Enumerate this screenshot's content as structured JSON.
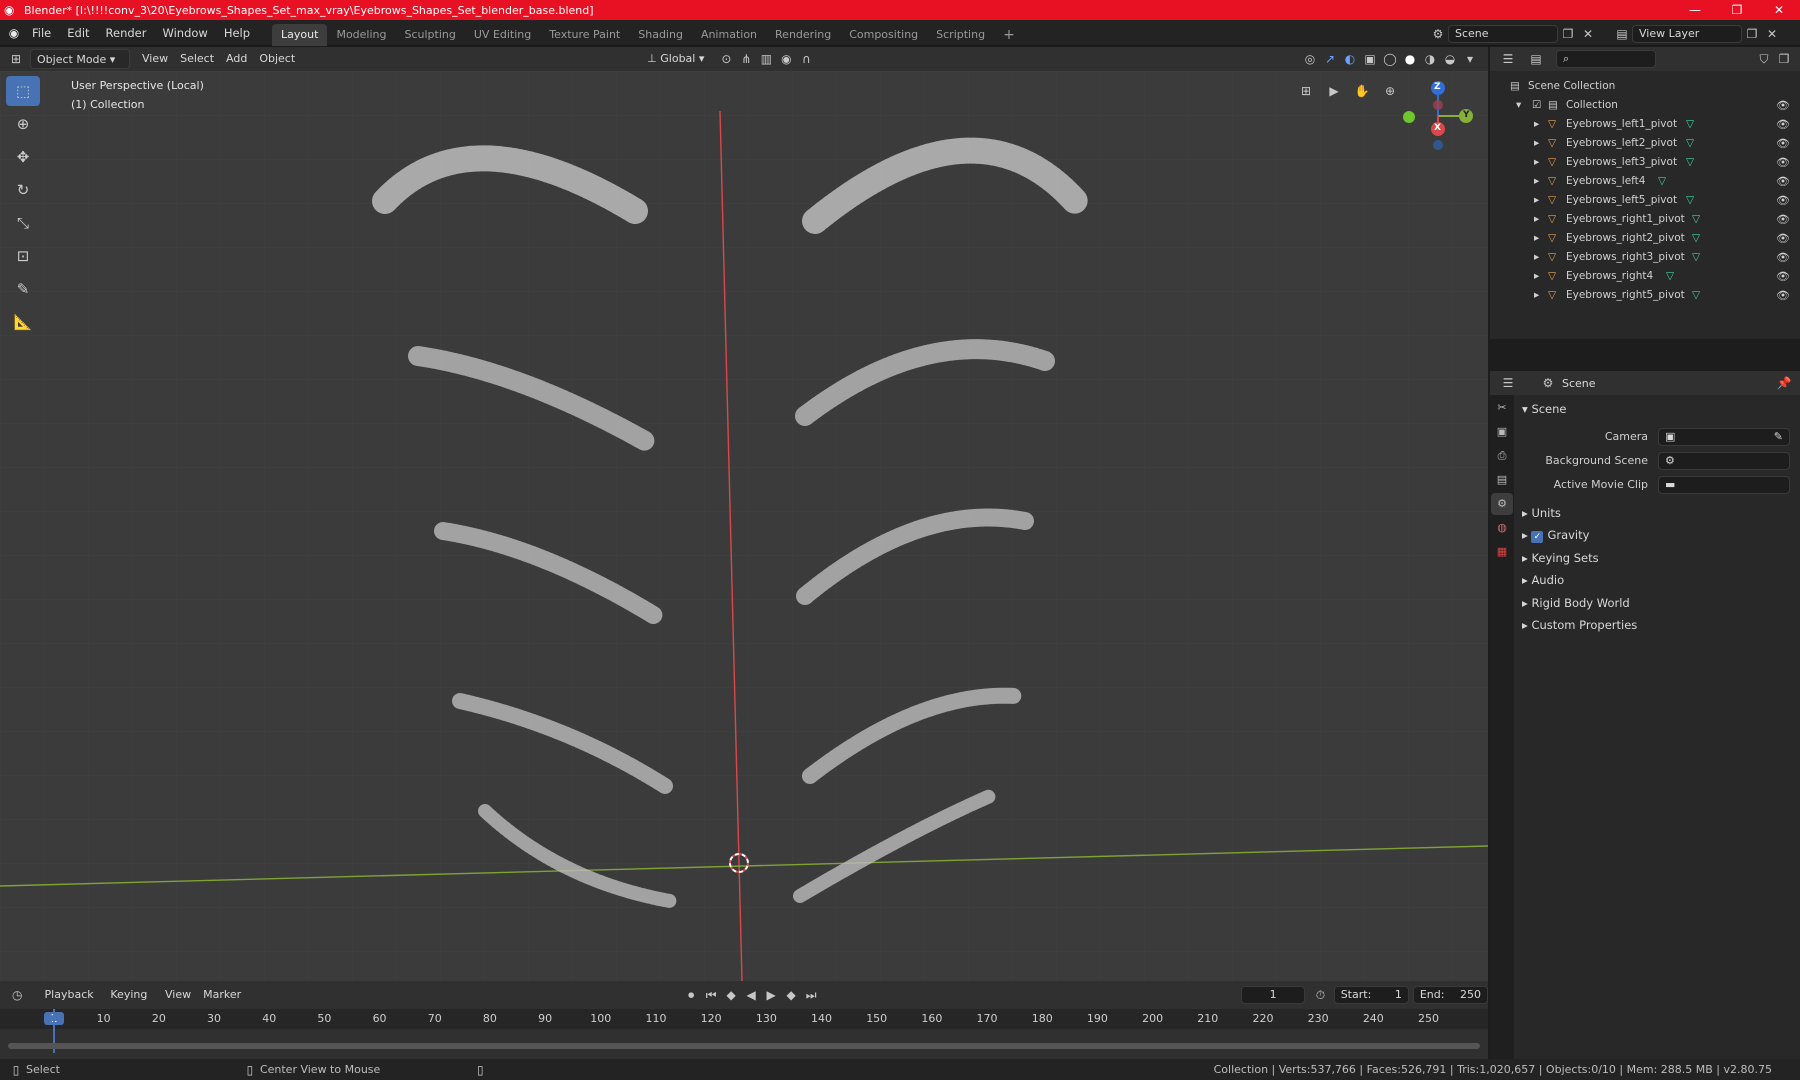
{
  "window": {
    "title": "Blender* [I:\\!!!!conv_3\\20\\Eyebrows_Shapes_Set_max_vray\\Eyebrows_Shapes_Set_blender_base.blend]",
    "controls": [
      "—",
      "❐",
      "✕"
    ]
  },
  "menu": {
    "items": [
      "File",
      "Edit",
      "Render",
      "Window",
      "Help"
    ],
    "workspaces": [
      "Layout",
      "Modeling",
      "Sculpting",
      "UV Editing",
      "Texture Paint",
      "Shading",
      "Animation",
      "Rendering",
      "Compositing",
      "Scripting"
    ],
    "active_workspace": "Layout",
    "add_tab": "+",
    "scene_name": "Scene",
    "view_layer": "View Layer"
  },
  "viewport_header": {
    "mode": "Object Mode",
    "menus": [
      "View",
      "Select",
      "Add",
      "Object"
    ],
    "orientation": "Global"
  },
  "viewport": {
    "perspective_label": "User Perspective (Local)",
    "collection_label": "(1) Collection",
    "gizmo": {
      "z": "Z",
      "y": "Y",
      "x": "X"
    }
  },
  "outliner": {
    "root": "Scene Collection",
    "collection": "Collection",
    "items": [
      {
        "name": "Eyebrows_left1_pivot"
      },
      {
        "name": "Eyebrows_left2_pivot"
      },
      {
        "name": "Eyebrows_left3_pivot"
      },
      {
        "name": "Eyebrows_left4"
      },
      {
        "name": "Eyebrows_left5_pivot"
      },
      {
        "name": "Eyebrows_right1_pivot"
      },
      {
        "name": "Eyebrows_right2_pivot"
      },
      {
        "name": "Eyebrows_right3_pivot"
      },
      {
        "name": "Eyebrows_right4"
      },
      {
        "name": "Eyebrows_right5_pivot"
      }
    ]
  },
  "properties": {
    "context": "Scene",
    "panel": "Scene",
    "fields": [
      {
        "label": "Camera"
      },
      {
        "label": "Background Scene"
      },
      {
        "label": "Active Movie Clip"
      }
    ],
    "sections": [
      "Units",
      "Gravity",
      "Keying Sets",
      "Audio",
      "Rigid Body World",
      "Custom Properties"
    ],
    "gravity_checked": true
  },
  "timeline": {
    "menus": [
      "Playback",
      "Keying",
      "View",
      "Marker"
    ],
    "current_frame": "1",
    "start_label": "Start:",
    "start": "1",
    "end_label": "End:",
    "end": "250",
    "ruler": [
      "1",
      "10",
      "20",
      "30",
      "40",
      "50",
      "60",
      "70",
      "80",
      "90",
      "100",
      "110",
      "120",
      "130",
      "140",
      "150",
      "160",
      "170",
      "180",
      "190",
      "200",
      "210",
      "220",
      "230",
      "240",
      "250"
    ]
  },
  "status": {
    "left": "Select",
    "middle": "Center View to Mouse",
    "right": "Collection | Verts:537,766 | Faces:526,791 | Tris:1,020,657 | Objects:0/10 | Mem: 288.5 MB | v2.80.75"
  },
  "colors": {
    "accent": "#4772b3",
    "titlebar": "#e81123",
    "mesh_icon": "#e8a150",
    "data_icon": "#3fd6a3"
  }
}
